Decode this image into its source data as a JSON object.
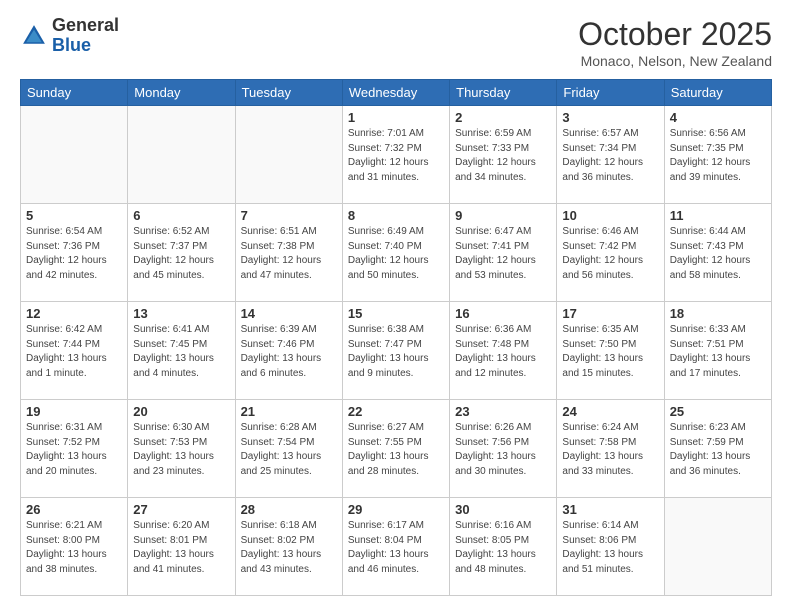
{
  "header": {
    "logo_general": "General",
    "logo_blue": "Blue",
    "month_title": "October 2025",
    "location": "Monaco, Nelson, New Zealand"
  },
  "days_of_week": [
    "Sunday",
    "Monday",
    "Tuesday",
    "Wednesday",
    "Thursday",
    "Friday",
    "Saturday"
  ],
  "weeks": [
    [
      {
        "day": "",
        "info": ""
      },
      {
        "day": "",
        "info": ""
      },
      {
        "day": "",
        "info": ""
      },
      {
        "day": "1",
        "info": "Sunrise: 7:01 AM\nSunset: 7:32 PM\nDaylight: 12 hours and 31 minutes."
      },
      {
        "day": "2",
        "info": "Sunrise: 6:59 AM\nSunset: 7:33 PM\nDaylight: 12 hours and 34 minutes."
      },
      {
        "day": "3",
        "info": "Sunrise: 6:57 AM\nSunset: 7:34 PM\nDaylight: 12 hours and 36 minutes."
      },
      {
        "day": "4",
        "info": "Sunrise: 6:56 AM\nSunset: 7:35 PM\nDaylight: 12 hours and 39 minutes."
      }
    ],
    [
      {
        "day": "5",
        "info": "Sunrise: 6:54 AM\nSunset: 7:36 PM\nDaylight: 12 hours and 42 minutes."
      },
      {
        "day": "6",
        "info": "Sunrise: 6:52 AM\nSunset: 7:37 PM\nDaylight: 12 hours and 45 minutes."
      },
      {
        "day": "7",
        "info": "Sunrise: 6:51 AM\nSunset: 7:38 PM\nDaylight: 12 hours and 47 minutes."
      },
      {
        "day": "8",
        "info": "Sunrise: 6:49 AM\nSunset: 7:40 PM\nDaylight: 12 hours and 50 minutes."
      },
      {
        "day": "9",
        "info": "Sunrise: 6:47 AM\nSunset: 7:41 PM\nDaylight: 12 hours and 53 minutes."
      },
      {
        "day": "10",
        "info": "Sunrise: 6:46 AM\nSunset: 7:42 PM\nDaylight: 12 hours and 56 minutes."
      },
      {
        "day": "11",
        "info": "Sunrise: 6:44 AM\nSunset: 7:43 PM\nDaylight: 12 hours and 58 minutes."
      }
    ],
    [
      {
        "day": "12",
        "info": "Sunrise: 6:42 AM\nSunset: 7:44 PM\nDaylight: 13 hours and 1 minute."
      },
      {
        "day": "13",
        "info": "Sunrise: 6:41 AM\nSunset: 7:45 PM\nDaylight: 13 hours and 4 minutes."
      },
      {
        "day": "14",
        "info": "Sunrise: 6:39 AM\nSunset: 7:46 PM\nDaylight: 13 hours and 6 minutes."
      },
      {
        "day": "15",
        "info": "Sunrise: 6:38 AM\nSunset: 7:47 PM\nDaylight: 13 hours and 9 minutes."
      },
      {
        "day": "16",
        "info": "Sunrise: 6:36 AM\nSunset: 7:48 PM\nDaylight: 13 hours and 12 minutes."
      },
      {
        "day": "17",
        "info": "Sunrise: 6:35 AM\nSunset: 7:50 PM\nDaylight: 13 hours and 15 minutes."
      },
      {
        "day": "18",
        "info": "Sunrise: 6:33 AM\nSunset: 7:51 PM\nDaylight: 13 hours and 17 minutes."
      }
    ],
    [
      {
        "day": "19",
        "info": "Sunrise: 6:31 AM\nSunset: 7:52 PM\nDaylight: 13 hours and 20 minutes."
      },
      {
        "day": "20",
        "info": "Sunrise: 6:30 AM\nSunset: 7:53 PM\nDaylight: 13 hours and 23 minutes."
      },
      {
        "day": "21",
        "info": "Sunrise: 6:28 AM\nSunset: 7:54 PM\nDaylight: 13 hours and 25 minutes."
      },
      {
        "day": "22",
        "info": "Sunrise: 6:27 AM\nSunset: 7:55 PM\nDaylight: 13 hours and 28 minutes."
      },
      {
        "day": "23",
        "info": "Sunrise: 6:26 AM\nSunset: 7:56 PM\nDaylight: 13 hours and 30 minutes."
      },
      {
        "day": "24",
        "info": "Sunrise: 6:24 AM\nSunset: 7:58 PM\nDaylight: 13 hours and 33 minutes."
      },
      {
        "day": "25",
        "info": "Sunrise: 6:23 AM\nSunset: 7:59 PM\nDaylight: 13 hours and 36 minutes."
      }
    ],
    [
      {
        "day": "26",
        "info": "Sunrise: 6:21 AM\nSunset: 8:00 PM\nDaylight: 13 hours and 38 minutes."
      },
      {
        "day": "27",
        "info": "Sunrise: 6:20 AM\nSunset: 8:01 PM\nDaylight: 13 hours and 41 minutes."
      },
      {
        "day": "28",
        "info": "Sunrise: 6:18 AM\nSunset: 8:02 PM\nDaylight: 13 hours and 43 minutes."
      },
      {
        "day": "29",
        "info": "Sunrise: 6:17 AM\nSunset: 8:04 PM\nDaylight: 13 hours and 46 minutes."
      },
      {
        "day": "30",
        "info": "Sunrise: 6:16 AM\nSunset: 8:05 PM\nDaylight: 13 hours and 48 minutes."
      },
      {
        "day": "31",
        "info": "Sunrise: 6:14 AM\nSunset: 8:06 PM\nDaylight: 13 hours and 51 minutes."
      },
      {
        "day": "",
        "info": ""
      }
    ]
  ]
}
